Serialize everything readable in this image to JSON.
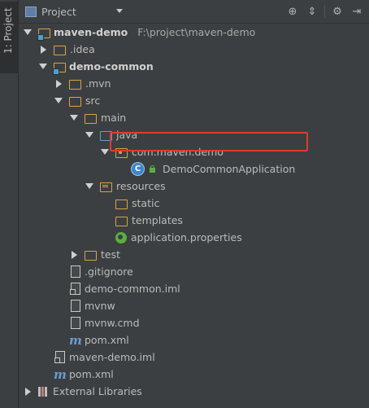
{
  "sidebar": {
    "tab_label": "1: Project"
  },
  "header": {
    "view_label": "Project",
    "toolbar": [
      {
        "name": "target-icon",
        "glyph": "⊕"
      },
      {
        "name": "collapse-icon",
        "glyph": "⇕"
      },
      {
        "name": "settings-icon",
        "glyph": "⚙"
      },
      {
        "name": "hide-icon",
        "glyph": "⇥"
      }
    ]
  },
  "tree": [
    {
      "label": "maven-demo",
      "extra": "F:\\project\\maven-demo",
      "arrow": "down",
      "icon": "module-folder",
      "indent": 0,
      "bold": true
    },
    {
      "label": ".idea",
      "arrow": "right",
      "icon": "folder",
      "indent": 1
    },
    {
      "label": "demo-common",
      "arrow": "down",
      "icon": "module-folder",
      "indent": 1,
      "bold": true
    },
    {
      "label": ".mvn",
      "arrow": "right",
      "icon": "folder",
      "indent": 2
    },
    {
      "label": "src",
      "arrow": "down",
      "icon": "folder",
      "indent": 2
    },
    {
      "label": "main",
      "arrow": "down",
      "icon": "folder",
      "indent": 3
    },
    {
      "label": "java",
      "arrow": "down",
      "icon": "source-folder",
      "indent": 4
    },
    {
      "label": "com.maven.demo",
      "arrow": "down",
      "icon": "package-folder",
      "indent": 5
    },
    {
      "label": "DemoCommonApplication",
      "arrow": "none",
      "icon": "class",
      "indent": 6,
      "highlighted": true
    },
    {
      "label": "resources",
      "arrow": "down",
      "icon": "resources-folder",
      "indent": 4
    },
    {
      "label": "static",
      "arrow": "none",
      "icon": "folder",
      "indent": 5
    },
    {
      "label": "templates",
      "arrow": "none",
      "icon": "folder",
      "indent": 5
    },
    {
      "label": "application.properties",
      "arrow": "none",
      "icon": "properties",
      "indent": 5
    },
    {
      "label": "test",
      "arrow": "right",
      "icon": "folder",
      "indent": 3
    },
    {
      "label": ".gitignore",
      "arrow": "none",
      "icon": "file",
      "indent": 2
    },
    {
      "label": "demo-common.iml",
      "arrow": "none",
      "icon": "iml",
      "indent": 2
    },
    {
      "label": "mvnw",
      "arrow": "none",
      "icon": "file",
      "indent": 2
    },
    {
      "label": "mvnw.cmd",
      "arrow": "none",
      "icon": "file",
      "indent": 2
    },
    {
      "label": "pom.xml",
      "arrow": "none",
      "icon": "maven",
      "indent": 2
    },
    {
      "label": "maven-demo.iml",
      "arrow": "none",
      "icon": "iml",
      "indent": 1
    },
    {
      "label": "pom.xml",
      "arrow": "none",
      "icon": "maven",
      "indent": 1
    },
    {
      "label": "External Libraries",
      "arrow": "right",
      "icon": "library",
      "indent": 0
    }
  ],
  "colors": {
    "highlight_border": "#e03a32",
    "background": "#3c3f41"
  }
}
